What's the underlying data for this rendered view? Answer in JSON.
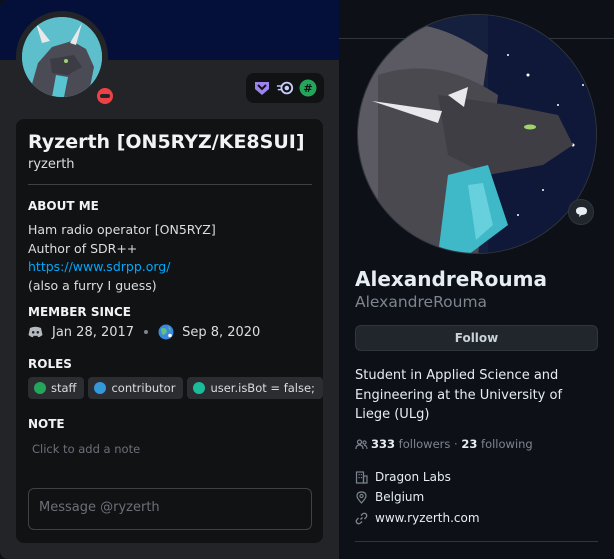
{
  "discord": {
    "display_name": "Ryzerth [ON5RYZ/KE8SUI]",
    "username": "ryzerth",
    "about_title": "ABOUT ME",
    "about_lines": [
      "Ham radio operator [ON5RYZ]",
      "Author of SDR++"
    ],
    "about_link": "https://www.sdrpp.org/",
    "about_last": "(also a furry I guess)",
    "member_since_title": "MEMBER SINCE",
    "discord_since": "Jan 28, 2017",
    "server_since": "Sep 8, 2020",
    "roles_title": "ROLES",
    "roles": [
      {
        "name": "staff",
        "color": "#23a55a"
      },
      {
        "name": "contributor",
        "color": "#3498db"
      },
      {
        "name": "user.isBot = false;",
        "color": "#1abc9c"
      }
    ],
    "note_title": "NOTE",
    "note_placeholder": "Click to add a note",
    "message_placeholder": "Message @ryzerth",
    "status": "do-not-disturb",
    "badge_icons": [
      "hypesquad-balance-icon",
      "nitro-icon",
      "active-developer-icon"
    ]
  },
  "github": {
    "name": "AlexandreRouma",
    "login": "AlexandreRouma",
    "follow_label": "Follow",
    "bio": "Student in Applied Science and Engineering at the University of Liege (ULg)",
    "followers_count": "333",
    "followers_label": "followers",
    "separator": "·",
    "following_count": "23",
    "following_label": "following",
    "company": "Dragon Labs",
    "location": "Belgium",
    "website": "www.ryzerth.com"
  },
  "colors": {
    "discord_bg": "#232428",
    "discord_banner": "#05103a",
    "discord_card": "#111214",
    "link": "#00a8fc",
    "github_bg": "#0d1117"
  }
}
